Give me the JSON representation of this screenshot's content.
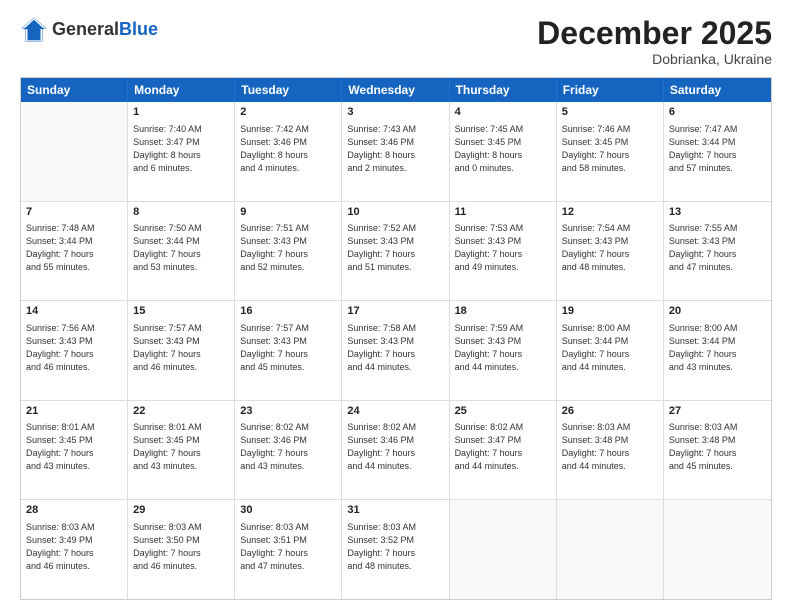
{
  "header": {
    "logo_general": "General",
    "logo_blue": "Blue",
    "month_title": "December 2025",
    "location": "Dobrianka, Ukraine"
  },
  "weekdays": [
    "Sunday",
    "Monday",
    "Tuesday",
    "Wednesday",
    "Thursday",
    "Friday",
    "Saturday"
  ],
  "weeks": [
    [
      {
        "day": "",
        "sunrise": "",
        "sunset": "",
        "daylight": ""
      },
      {
        "day": "1",
        "sunrise": "Sunrise: 7:40 AM",
        "sunset": "Sunset: 3:47 PM",
        "daylight": "Daylight: 8 hours",
        "daylight2": "and 6 minutes."
      },
      {
        "day": "2",
        "sunrise": "Sunrise: 7:42 AM",
        "sunset": "Sunset: 3:46 PM",
        "daylight": "Daylight: 8 hours",
        "daylight2": "and 4 minutes."
      },
      {
        "day": "3",
        "sunrise": "Sunrise: 7:43 AM",
        "sunset": "Sunset: 3:46 PM",
        "daylight": "Daylight: 8 hours",
        "daylight2": "and 2 minutes."
      },
      {
        "day": "4",
        "sunrise": "Sunrise: 7:45 AM",
        "sunset": "Sunset: 3:45 PM",
        "daylight": "Daylight: 8 hours",
        "daylight2": "and 0 minutes."
      },
      {
        "day": "5",
        "sunrise": "Sunrise: 7:46 AM",
        "sunset": "Sunset: 3:45 PM",
        "daylight": "Daylight: 7 hours",
        "daylight2": "and 58 minutes."
      },
      {
        "day": "6",
        "sunrise": "Sunrise: 7:47 AM",
        "sunset": "Sunset: 3:44 PM",
        "daylight": "Daylight: 7 hours",
        "daylight2": "and 57 minutes."
      }
    ],
    [
      {
        "day": "7",
        "sunrise": "Sunrise: 7:48 AM",
        "sunset": "Sunset: 3:44 PM",
        "daylight": "Daylight: 7 hours",
        "daylight2": "and 55 minutes."
      },
      {
        "day": "8",
        "sunrise": "Sunrise: 7:50 AM",
        "sunset": "Sunset: 3:44 PM",
        "daylight": "Daylight: 7 hours",
        "daylight2": "and 53 minutes."
      },
      {
        "day": "9",
        "sunrise": "Sunrise: 7:51 AM",
        "sunset": "Sunset: 3:43 PM",
        "daylight": "Daylight: 7 hours",
        "daylight2": "and 52 minutes."
      },
      {
        "day": "10",
        "sunrise": "Sunrise: 7:52 AM",
        "sunset": "Sunset: 3:43 PM",
        "daylight": "Daylight: 7 hours",
        "daylight2": "and 51 minutes."
      },
      {
        "day": "11",
        "sunrise": "Sunrise: 7:53 AM",
        "sunset": "Sunset: 3:43 PM",
        "daylight": "Daylight: 7 hours",
        "daylight2": "and 49 minutes."
      },
      {
        "day": "12",
        "sunrise": "Sunrise: 7:54 AM",
        "sunset": "Sunset: 3:43 PM",
        "daylight": "Daylight: 7 hours",
        "daylight2": "and 48 minutes."
      },
      {
        "day": "13",
        "sunrise": "Sunrise: 7:55 AM",
        "sunset": "Sunset: 3:43 PM",
        "daylight": "Daylight: 7 hours",
        "daylight2": "and 47 minutes."
      }
    ],
    [
      {
        "day": "14",
        "sunrise": "Sunrise: 7:56 AM",
        "sunset": "Sunset: 3:43 PM",
        "daylight": "Daylight: 7 hours",
        "daylight2": "and 46 minutes."
      },
      {
        "day": "15",
        "sunrise": "Sunrise: 7:57 AM",
        "sunset": "Sunset: 3:43 PM",
        "daylight": "Daylight: 7 hours",
        "daylight2": "and 46 minutes."
      },
      {
        "day": "16",
        "sunrise": "Sunrise: 7:57 AM",
        "sunset": "Sunset: 3:43 PM",
        "daylight": "Daylight: 7 hours",
        "daylight2": "and 45 minutes."
      },
      {
        "day": "17",
        "sunrise": "Sunrise: 7:58 AM",
        "sunset": "Sunset: 3:43 PM",
        "daylight": "Daylight: 7 hours",
        "daylight2": "and 44 minutes."
      },
      {
        "day": "18",
        "sunrise": "Sunrise: 7:59 AM",
        "sunset": "Sunset: 3:43 PM",
        "daylight": "Daylight: 7 hours",
        "daylight2": "and 44 minutes."
      },
      {
        "day": "19",
        "sunrise": "Sunrise: 8:00 AM",
        "sunset": "Sunset: 3:44 PM",
        "daylight": "Daylight: 7 hours",
        "daylight2": "and 44 minutes."
      },
      {
        "day": "20",
        "sunrise": "Sunrise: 8:00 AM",
        "sunset": "Sunset: 3:44 PM",
        "daylight": "Daylight: 7 hours",
        "daylight2": "and 43 minutes."
      }
    ],
    [
      {
        "day": "21",
        "sunrise": "Sunrise: 8:01 AM",
        "sunset": "Sunset: 3:45 PM",
        "daylight": "Daylight: 7 hours",
        "daylight2": "and 43 minutes."
      },
      {
        "day": "22",
        "sunrise": "Sunrise: 8:01 AM",
        "sunset": "Sunset: 3:45 PM",
        "daylight": "Daylight: 7 hours",
        "daylight2": "and 43 minutes."
      },
      {
        "day": "23",
        "sunrise": "Sunrise: 8:02 AM",
        "sunset": "Sunset: 3:46 PM",
        "daylight": "Daylight: 7 hours",
        "daylight2": "and 43 minutes."
      },
      {
        "day": "24",
        "sunrise": "Sunrise: 8:02 AM",
        "sunset": "Sunset: 3:46 PM",
        "daylight": "Daylight: 7 hours",
        "daylight2": "and 44 minutes."
      },
      {
        "day": "25",
        "sunrise": "Sunrise: 8:02 AM",
        "sunset": "Sunset: 3:47 PM",
        "daylight": "Daylight: 7 hours",
        "daylight2": "and 44 minutes."
      },
      {
        "day": "26",
        "sunrise": "Sunrise: 8:03 AM",
        "sunset": "Sunset: 3:48 PM",
        "daylight": "Daylight: 7 hours",
        "daylight2": "and 44 minutes."
      },
      {
        "day": "27",
        "sunrise": "Sunrise: 8:03 AM",
        "sunset": "Sunset: 3:48 PM",
        "daylight": "Daylight: 7 hours",
        "daylight2": "and 45 minutes."
      }
    ],
    [
      {
        "day": "28",
        "sunrise": "Sunrise: 8:03 AM",
        "sunset": "Sunset: 3:49 PM",
        "daylight": "Daylight: 7 hours",
        "daylight2": "and 46 minutes."
      },
      {
        "day": "29",
        "sunrise": "Sunrise: 8:03 AM",
        "sunset": "Sunset: 3:50 PM",
        "daylight": "Daylight: 7 hours",
        "daylight2": "and 46 minutes."
      },
      {
        "day": "30",
        "sunrise": "Sunrise: 8:03 AM",
        "sunset": "Sunset: 3:51 PM",
        "daylight": "Daylight: 7 hours",
        "daylight2": "and 47 minutes."
      },
      {
        "day": "31",
        "sunrise": "Sunrise: 8:03 AM",
        "sunset": "Sunset: 3:52 PM",
        "daylight": "Daylight: 7 hours",
        "daylight2": "and 48 minutes."
      },
      {
        "day": "",
        "sunrise": "",
        "sunset": "",
        "daylight": ""
      },
      {
        "day": "",
        "sunrise": "",
        "sunset": "",
        "daylight": ""
      },
      {
        "day": "",
        "sunrise": "",
        "sunset": "",
        "daylight": ""
      }
    ]
  ]
}
